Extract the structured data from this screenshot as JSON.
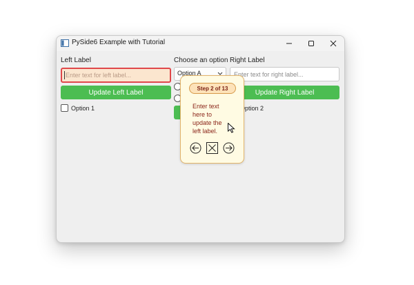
{
  "window": {
    "title": "PySide6 Example with Tutorial"
  },
  "left": {
    "label": "Left Label",
    "input_value": "",
    "input_placeholder": "Enter text for left label...",
    "button_label": "Update Left Label",
    "checkbox_label": "Option 1"
  },
  "middle": {
    "label": "Choose an option",
    "combo_value": "Option A"
  },
  "right": {
    "label": "Right Label",
    "input_value": "",
    "input_placeholder": "Enter text for right label...",
    "button_label": "Update Right Label",
    "checkbox_label": "Option 2"
  },
  "tutorial": {
    "step_label": "Step 2 of 13",
    "message": "Enter text\nhere to\nupdate the\nleft label."
  },
  "colors": {
    "accent_green": "#4cbd52",
    "highlight_border": "#e0474a",
    "tip_text": "#8a2418"
  },
  "icons": {
    "back": "arrow-left-circle",
    "close": "close-box",
    "next": "arrow-right-circle"
  }
}
